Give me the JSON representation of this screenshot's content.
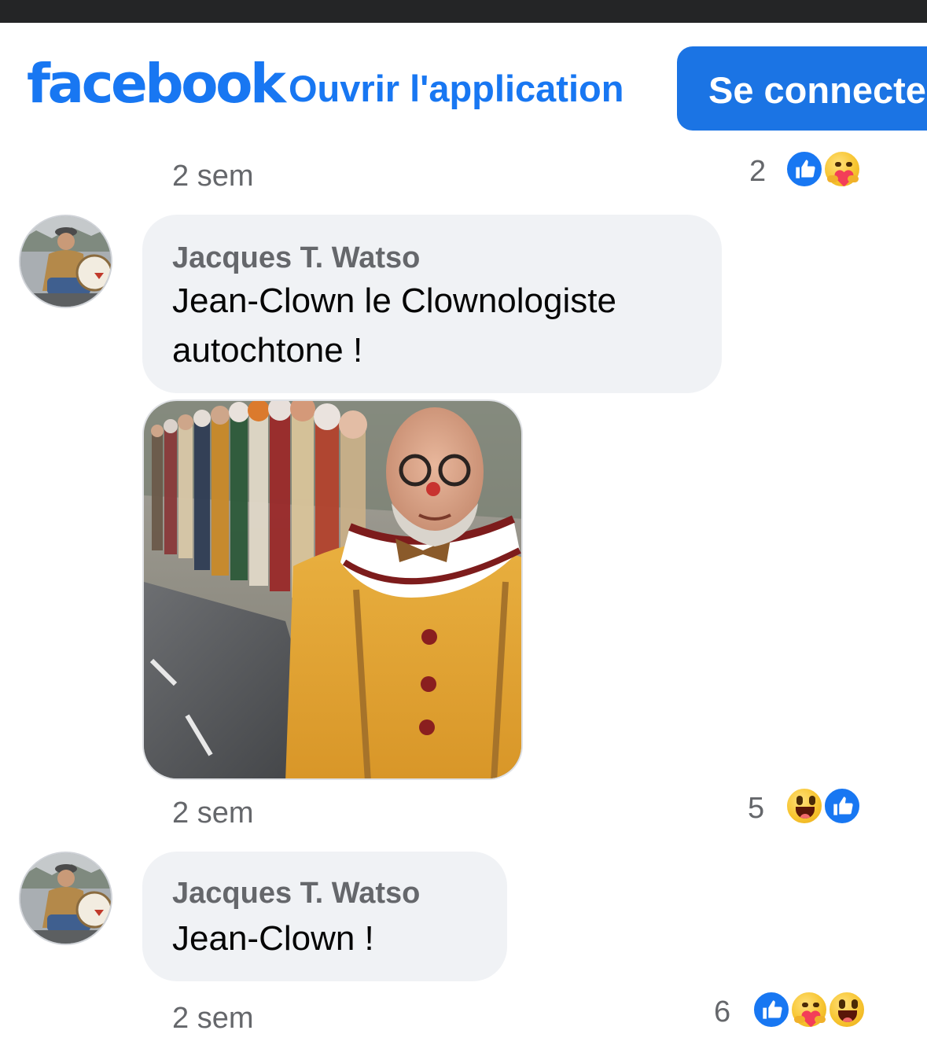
{
  "header": {
    "logo": "facebook",
    "open_app": "Ouvrir l'application",
    "login_button": "Se connecter"
  },
  "comments": [
    {
      "time": "2 sem",
      "reaction_count": "2",
      "reactions": [
        "like-icon",
        "care-icon"
      ]
    },
    {
      "author": "Jacques T. Watso",
      "text_lines": [
        "Jean-Clown le Clownologiste",
        "autochtone !"
      ],
      "has_image": true,
      "time": "2 sem",
      "reaction_count": "5",
      "reactions": [
        "haha-icon",
        "like-icon"
      ]
    },
    {
      "author": "Jacques T. Watso",
      "text_lines": [
        "Jean-Clown !"
      ],
      "time": "2 sem",
      "reaction_count": "6",
      "reactions": [
        "like-icon",
        "care-icon",
        "haha-icon"
      ]
    }
  ],
  "colors": {
    "brand": "#1877f2",
    "bubble": "#f0f2f5",
    "secondary_text": "#65676b",
    "status_bar": "#242526"
  }
}
